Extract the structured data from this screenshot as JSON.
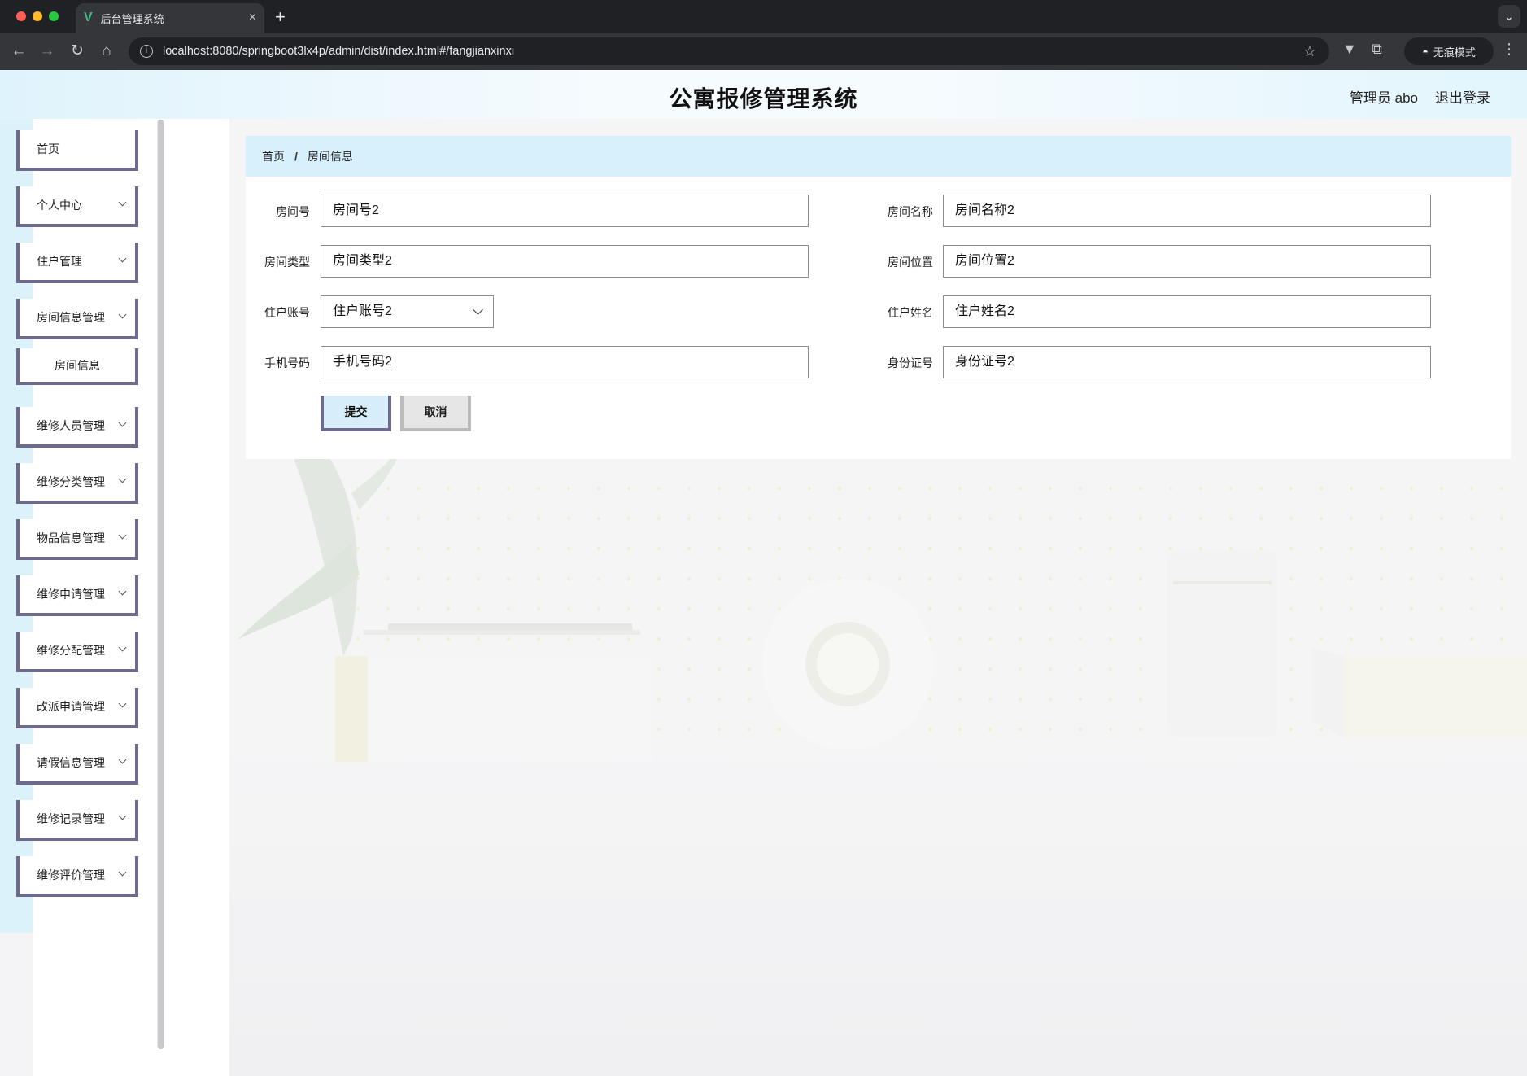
{
  "browser": {
    "tab_title": "后台管理系统",
    "url": "localhost:8080/springboot3lx4p/admin/dist/index.html#/fangjianxinxi",
    "incognito_label": "无痕模式"
  },
  "header": {
    "title": "公寓报修管理系统",
    "user": "管理员 abo",
    "logout": "退出登录"
  },
  "sidebar": {
    "items": [
      {
        "label": "首页"
      },
      {
        "label": "个人中心"
      },
      {
        "label": "住户管理"
      },
      {
        "label": "房间信息管理"
      },
      {
        "label": "房间信息"
      },
      {
        "label": "维修人员管理"
      },
      {
        "label": "维修分类管理"
      },
      {
        "label": "物品信息管理"
      },
      {
        "label": "维修申请管理"
      },
      {
        "label": "维修分配管理"
      },
      {
        "label": "改派申请管理"
      },
      {
        "label": "请假信息管理"
      },
      {
        "label": "维修记录管理"
      },
      {
        "label": "维修评价管理"
      }
    ]
  },
  "breadcrumb": {
    "home": "首页",
    "sep": "/",
    "current": "房间信息"
  },
  "form": {
    "room_no": {
      "label": "房间号",
      "value": "房间号2"
    },
    "room_name": {
      "label": "房间名称",
      "value": "房间名称2"
    },
    "room_type": {
      "label": "房间类型",
      "value": "房间类型2"
    },
    "room_location": {
      "label": "房间位置",
      "value": "房间位置2"
    },
    "resident_account": {
      "label": "住户账号",
      "value": "住户账号2"
    },
    "resident_name": {
      "label": "住户姓名",
      "value": "住户姓名2"
    },
    "phone": {
      "label": "手机号码",
      "value": "手机号码2"
    },
    "id_card": {
      "label": "身份证号",
      "value": "身份证号2"
    }
  },
  "buttons": {
    "submit": "提交",
    "cancel": "取消"
  },
  "colors": {
    "accent_border": "#6e6a8c",
    "breadcrumb_bg": "#d8f0fb",
    "header_bg": "#dff3fc"
  }
}
